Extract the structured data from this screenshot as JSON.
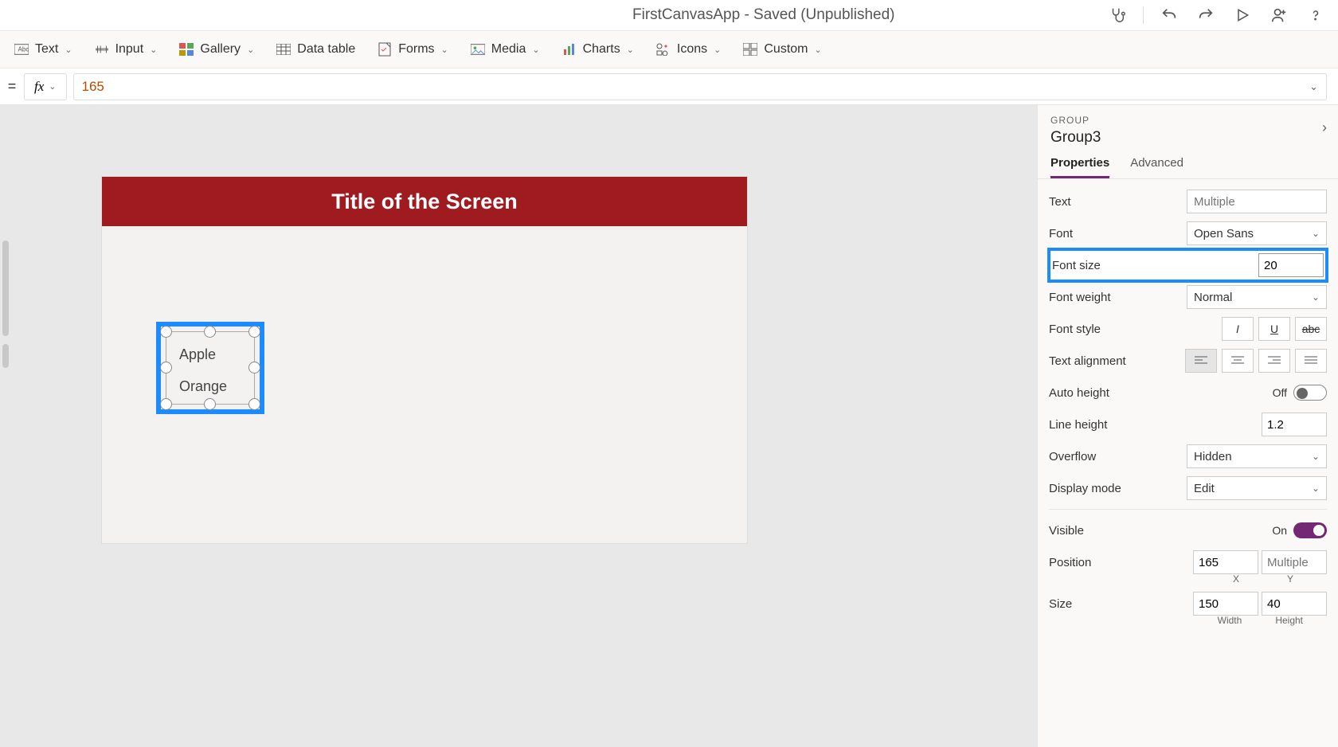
{
  "titlebar": {
    "title": "FirstCanvasApp - Saved (Unpublished)"
  },
  "ribbon": {
    "text": "Text",
    "input": "Input",
    "gallery": "Gallery",
    "datatable": "Data table",
    "forms": "Forms",
    "media": "Media",
    "charts": "Charts",
    "icons": "Icons",
    "custom": "Custom"
  },
  "formula": {
    "value": "165"
  },
  "canvas": {
    "title": "Title of the Screen",
    "item1": "Apple",
    "item2": "Orange"
  },
  "panel": {
    "type": "GROUP",
    "name": "Group3",
    "tabs": {
      "properties": "Properties",
      "advanced": "Advanced"
    },
    "text": {
      "label": "Text",
      "placeholder": "Multiple"
    },
    "font": {
      "label": "Font",
      "value": "Open Sans"
    },
    "fontsize": {
      "label": "Font size",
      "value": "20"
    },
    "fontweight": {
      "label": "Font weight",
      "value": "Normal"
    },
    "fontstyle": {
      "label": "Font style"
    },
    "textalign": {
      "label": "Text alignment"
    },
    "autoheight": {
      "label": "Auto height",
      "state": "Off"
    },
    "lineheight": {
      "label": "Line height",
      "value": "1.2"
    },
    "overflow": {
      "label": "Overflow",
      "value": "Hidden"
    },
    "displaymode": {
      "label": "Display mode",
      "value": "Edit"
    },
    "visible": {
      "label": "Visible",
      "state": "On"
    },
    "position": {
      "label": "Position",
      "x": "165",
      "y_placeholder": "Multiple",
      "xl": "X",
      "yl": "Y"
    },
    "size": {
      "label": "Size",
      "w": "150",
      "h": "40",
      "wl": "Width",
      "hl": "Height"
    }
  }
}
